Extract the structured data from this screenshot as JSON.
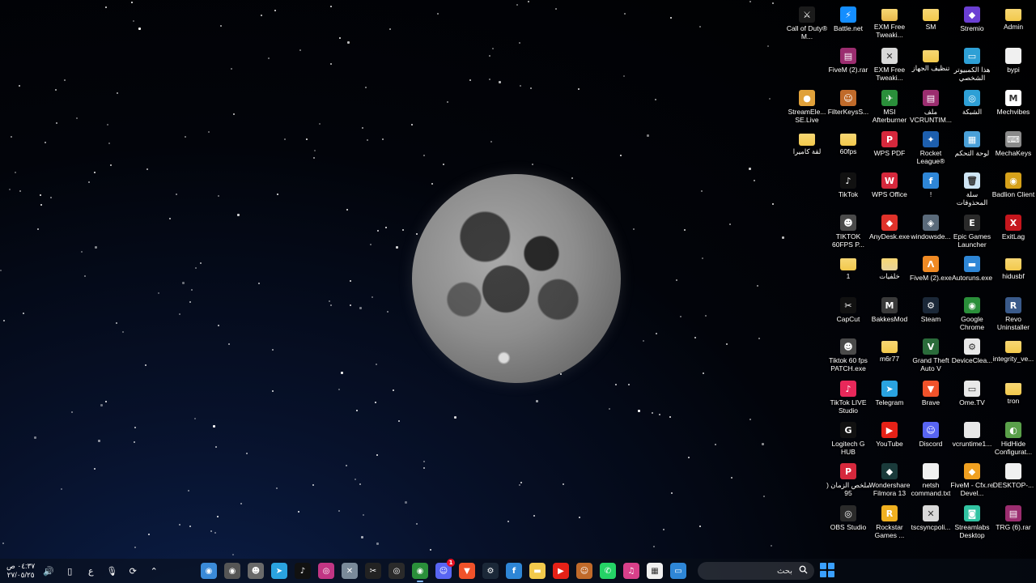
{
  "desktop": {
    "icons": [
      {
        "label": "Call of Duty® M...",
        "icon": "cod-icon",
        "color": "#1b1b1b",
        "glyph": "⚔",
        "col": 0,
        "row": 0
      },
      {
        "label": "Battle.net",
        "icon": "battlenet-icon",
        "color": "#148eff",
        "glyph": "⚡",
        "col": 1,
        "row": 0
      },
      {
        "label": "EXM Free Tweaki...",
        "icon": "folder-icon",
        "color": "#e8b84a",
        "glyph": "",
        "col": 2,
        "row": 0
      },
      {
        "label": "SM",
        "icon": "folder-icon",
        "color": "#f2c94c",
        "glyph": "",
        "col": 3,
        "row": 0
      },
      {
        "label": "Stremio",
        "icon": "stremio-icon",
        "color": "#6b3fd3",
        "glyph": "◆",
        "col": 4,
        "row": 0
      },
      {
        "label": "Admin",
        "icon": "folder-icon",
        "color": "#f2c94c",
        "glyph": "",
        "col": 5,
        "row": 0
      },
      {
        "label": "FiveM (2).rar",
        "icon": "winrar-icon",
        "color": "#9b2d6f",
        "glyph": "▤",
        "col": 1,
        "row": 1
      },
      {
        "label": "EXM Free Tweaki...",
        "icon": "shortcut-icon",
        "color": "#d9d9d9",
        "glyph": "✕",
        "col": 2,
        "row": 1
      },
      {
        "label": "تنظيف الجهاز",
        "icon": "folder-icon",
        "color": "#f2c94c",
        "glyph": "",
        "col": 3,
        "row": 1
      },
      {
        "label": "هذا الكمبيوتر الشخصي",
        "icon": "this-pc-icon",
        "color": "#2ea0d6",
        "glyph": "▭",
        "col": 4,
        "row": 1
      },
      {
        "label": "bypi",
        "icon": "file-icon",
        "color": "#f0f0f0",
        "glyph": "",
        "col": 5,
        "row": 1
      },
      {
        "label": "StreamEle... SE.Live",
        "icon": "streamelements-icon",
        "color": "#e0a13a",
        "glyph": "●",
        "col": 0,
        "row": 2
      },
      {
        "label": "FilterKeysS...",
        "icon": "filterkeys-icon",
        "color": "#c06a2a",
        "glyph": "☺",
        "col": 1,
        "row": 2
      },
      {
        "label": "MSI Afterburner",
        "icon": "msi-afterburner-icon",
        "color": "#2a8f3a",
        "glyph": "✈",
        "col": 2,
        "row": 2
      },
      {
        "label": "ملف VCRUNTIM...",
        "icon": "winrar-icon",
        "color": "#9b2d6f",
        "glyph": "▤",
        "col": 3,
        "row": 2
      },
      {
        "label": "الشبكة",
        "icon": "network-icon",
        "color": "#2ea0d6",
        "glyph": "◎",
        "col": 4,
        "row": 2
      },
      {
        "label": "Mechvibes",
        "icon": "mechvibes-icon",
        "color": "#ffffff",
        "glyph": "M",
        "col": 5,
        "row": 2
      },
      {
        "label": "لقة كاميرا",
        "icon": "folder-icon",
        "color": "#f2c94c",
        "glyph": "",
        "col": 0,
        "row": 3
      },
      {
        "label": "60fps",
        "icon": "folder-icon",
        "color": "#f2c94c",
        "glyph": "",
        "col": 1,
        "row": 3
      },
      {
        "label": "WPS PDF",
        "icon": "wps-pdf-icon",
        "color": "#d6283c",
        "glyph": "P",
        "col": 2,
        "row": 3
      },
      {
        "label": "Rocket League®",
        "icon": "rocket-league-icon",
        "color": "#1d5fae",
        "glyph": "✦",
        "col": 3,
        "row": 3
      },
      {
        "label": "لوحة التحكم",
        "icon": "control-panel-icon",
        "color": "#4aa0d8",
        "glyph": "▦",
        "col": 4,
        "row": 3
      },
      {
        "label": "MechaKeys",
        "icon": "mechakeys-icon",
        "color": "#8a8a8a",
        "glyph": "⌨",
        "col": 5,
        "row": 3
      },
      {
        "label": "TikTok",
        "icon": "tiktok-icon",
        "color": "#111111",
        "glyph": "♪",
        "col": 1,
        "row": 4
      },
      {
        "label": "WPS Office",
        "icon": "wps-office-icon",
        "color": "#d6283c",
        "glyph": "W",
        "col": 2,
        "row": 4
      },
      {
        "label": "!",
        "icon": "fivem-file-icon",
        "color": "#2e86d6",
        "glyph": "f",
        "col": 3,
        "row": 4
      },
      {
        "label": "سلة المحذوفات",
        "icon": "recycle-bin-icon",
        "color": "#cfe6f5",
        "glyph": "🗑",
        "col": 4,
        "row": 4
      },
      {
        "label": "Badlion Client",
        "icon": "badlion-icon",
        "color": "#d6a11a",
        "glyph": "◉",
        "col": 5,
        "row": 4
      },
      {
        "label": "TIKTOK 60FPS P...",
        "icon": "avatar-icon",
        "color": "#4a4a4a",
        "glyph": "☻",
        "col": 1,
        "row": 5
      },
      {
        "label": "AnyDesk.exe",
        "icon": "anydesk-icon",
        "color": "#e0322a",
        "glyph": "◆",
        "col": 2,
        "row": 5
      },
      {
        "label": "windowsde...",
        "icon": "windowsdefender-icon",
        "color": "#5a6a7a",
        "glyph": "◈",
        "col": 3,
        "row": 5
      },
      {
        "label": "Epic Games Launcher",
        "icon": "epic-games-icon",
        "color": "#2a2a2a",
        "glyph": "E",
        "col": 4,
        "row": 5
      },
      {
        "label": "ExitLag",
        "icon": "exitlag-icon",
        "color": "#c5161d",
        "glyph": "X",
        "col": 5,
        "row": 5
      },
      {
        "label": "1",
        "icon": "folder-icon",
        "color": "#f2c94c",
        "glyph": "",
        "col": 1,
        "row": 6
      },
      {
        "label": "خلفيات",
        "icon": "folder-icon",
        "color": "#e8d39a",
        "glyph": "",
        "col": 2,
        "row": 6
      },
      {
        "label": "FiveM (2).exe",
        "icon": "fivem-icon",
        "color": "#f08a24",
        "glyph": "Λ",
        "col": 3,
        "row": 6
      },
      {
        "label": "Autoruns.exe",
        "icon": "autoruns-icon",
        "color": "#2e86d6",
        "glyph": "▬",
        "col": 4,
        "row": 6
      },
      {
        "label": "hidusbf",
        "icon": "folder-icon",
        "color": "#f2c94c",
        "glyph": "",
        "col": 5,
        "row": 6
      },
      {
        "label": "CapCut",
        "icon": "capcut-icon",
        "color": "#111111",
        "glyph": "✂",
        "col": 1,
        "row": 7
      },
      {
        "label": "BakkesMod",
        "icon": "bakkesmod-icon",
        "color": "#3a3a3a",
        "glyph": "M",
        "col": 2,
        "row": 7
      },
      {
        "label": "Steam",
        "icon": "steam-icon",
        "color": "#1b2838",
        "glyph": "⚙",
        "col": 3,
        "row": 7
      },
      {
        "label": "Google Chrome",
        "icon": "chrome-icon",
        "color": "#2a8f3a",
        "glyph": "◉",
        "col": 4,
        "row": 7
      },
      {
        "label": "Revo Uninstaller",
        "icon": "revo-icon",
        "color": "#3a5a8a",
        "glyph": "R",
        "col": 5,
        "row": 7
      },
      {
        "label": "Tiktok 60 fps PATCH.exe",
        "icon": "avatar-icon",
        "color": "#4a4a4a",
        "glyph": "☻",
        "col": 1,
        "row": 8
      },
      {
        "label": "m6r77",
        "icon": "folder-icon",
        "color": "#f2c94c",
        "glyph": "",
        "col": 2,
        "row": 8
      },
      {
        "label": "Grand Theft Auto V",
        "icon": "gta-icon",
        "color": "#2a6b3a",
        "glyph": "V",
        "col": 3,
        "row": 8
      },
      {
        "label": "DeviceClea...",
        "icon": "deviceclean-icon",
        "color": "#e8e8e8",
        "glyph": "⚙",
        "col": 4,
        "row": 8
      },
      {
        "label": "integrity_ve...",
        "icon": "folder-icon",
        "color": "#f2c94c",
        "glyph": "",
        "col": 5,
        "row": 8
      },
      {
        "label": "TikTok LIVE Studio",
        "icon": "tiktok-live-icon",
        "color": "#e8285a",
        "glyph": "♪",
        "col": 1,
        "row": 9
      },
      {
        "label": "Telegram",
        "icon": "telegram-icon",
        "color": "#2aa3e0",
        "glyph": "➤",
        "col": 2,
        "row": 9
      },
      {
        "label": "Brave",
        "icon": "brave-icon",
        "color": "#f0522a",
        "glyph": "▼",
        "col": 3,
        "row": 9
      },
      {
        "label": "Ome.TV",
        "icon": "ometv-icon",
        "color": "#e8e8e8",
        "glyph": "▭",
        "col": 4,
        "row": 9
      },
      {
        "label": "tron",
        "icon": "folder-icon",
        "color": "#f2c94c",
        "glyph": "",
        "col": 5,
        "row": 9
      },
      {
        "label": "Logitech G HUB",
        "icon": "logitech-icon",
        "color": "#111111",
        "glyph": "G",
        "col": 1,
        "row": 10
      },
      {
        "label": "YouTube",
        "icon": "youtube-icon",
        "color": "#e62117",
        "glyph": "▶",
        "col": 2,
        "row": 10
      },
      {
        "label": "Discord",
        "icon": "discord-icon",
        "color": "#5865f2",
        "glyph": "☺",
        "col": 3,
        "row": 10
      },
      {
        "label": "vcruntime1...",
        "icon": "file-icon",
        "color": "#e8e8e8",
        "glyph": "",
        "col": 4,
        "row": 10
      },
      {
        "label": "HidHide Configurat...",
        "icon": "hidhide-icon",
        "color": "#5aa04a",
        "glyph": "◐",
        "col": 5,
        "row": 10
      },
      {
        "label": "ملخص الزمان ( 95",
        "icon": "pdf-icon",
        "color": "#d6283c",
        "glyph": "P",
        "col": 1,
        "row": 11
      },
      {
        "label": "Wondershare Filmora 13",
        "icon": "filmora-icon",
        "color": "#1a3a3a",
        "glyph": "◆",
        "col": 2,
        "row": 11
      },
      {
        "label": "netsh command.txt",
        "icon": "text-file-icon",
        "color": "#f0f0f0",
        "glyph": "",
        "col": 3,
        "row": 11
      },
      {
        "label": "FiveM - Cfx.re Devel...",
        "icon": "fivem-dev-icon",
        "color": "#f0a020",
        "glyph": "◆",
        "col": 4,
        "row": 11
      },
      {
        "label": "DESKTOP-...",
        "icon": "file-icon",
        "color": "#f0f0f0",
        "glyph": "",
        "col": 5,
        "row": 11
      },
      {
        "label": "OBS Studio",
        "icon": "obs-icon",
        "color": "#2a2a2a",
        "glyph": "◎",
        "col": 1,
        "row": 12
      },
      {
        "label": "Rockstar Games ...",
        "icon": "rockstar-icon",
        "color": "#f0b020",
        "glyph": "R",
        "col": 2,
        "row": 12
      },
      {
        "label": "tscsyncpoli...",
        "icon": "shortcut-icon",
        "color": "#d9d9d9",
        "glyph": "✕",
        "col": 3,
        "row": 12
      },
      {
        "label": "Streamlabs Desktop",
        "icon": "streamlabs-icon",
        "color": "#31c3a2",
        "glyph": "◙",
        "col": 4,
        "row": 12
      },
      {
        "label": "TRG (6).rar",
        "icon": "winrar-icon",
        "color": "#9b2d6f",
        "glyph": "▤",
        "col": 5,
        "row": 12
      }
    ]
  },
  "taskbar": {
    "clock_time": "٠٤:٣٧ ص",
    "clock_date": "٢٧/٠٥/٢٥",
    "lang": "ع",
    "search_placeholder": "بحث",
    "tray": [
      {
        "icon": "volume-icon",
        "glyph": "🔊"
      },
      {
        "icon": "network-icon",
        "glyph": "▯"
      },
      {
        "icon": "microphone-icon",
        "glyph": "🎙"
      },
      {
        "icon": "sync-icon",
        "glyph": "⟳"
      },
      {
        "icon": "chevron-up-icon",
        "glyph": "⌃"
      }
    ],
    "apps": [
      {
        "icon": "safari-icon",
        "color": "#3a8ad8",
        "glyph": "◉"
      },
      {
        "icon": "app-icon",
        "color": "#555555",
        "glyph": "◉",
        "badge": ""
      },
      {
        "icon": "avatar-app-icon",
        "color": "#6a6a6a",
        "glyph": "☻"
      },
      {
        "icon": "telegram-icon",
        "color": "#2aa3e0",
        "glyph": "➤"
      },
      {
        "icon": "tiktok-icon",
        "color": "#111111",
        "glyph": "♪"
      },
      {
        "icon": "instagram-icon",
        "color": "#c13584",
        "glyph": "◎"
      },
      {
        "icon": "tool-icon",
        "color": "#7a8a9a",
        "glyph": "✕"
      },
      {
        "icon": "capcut-icon",
        "color": "#222222",
        "glyph": "✂"
      },
      {
        "icon": "obs-icon",
        "color": "#2a2a2a",
        "glyph": "◎"
      },
      {
        "icon": "chrome-icon",
        "color": "#2a8f3a",
        "glyph": "◉",
        "active": true
      },
      {
        "icon": "discord-icon",
        "color": "#5865f2",
        "glyph": "☺",
        "badge": "1"
      },
      {
        "icon": "brave-icon",
        "color": "#f0522a",
        "glyph": "▼"
      },
      {
        "icon": "steam-icon",
        "color": "#1b2838",
        "glyph": "⚙"
      },
      {
        "icon": "fivem-file-icon",
        "color": "#2e86d6",
        "glyph": "f"
      },
      {
        "icon": "file-explorer-icon",
        "color": "#f2c94c",
        "glyph": "▬"
      },
      {
        "icon": "youtube-icon",
        "color": "#e62117",
        "glyph": "▶"
      },
      {
        "icon": "store-icon",
        "color": "#c06a2a",
        "glyph": "☺"
      },
      {
        "icon": "whatsapp-icon",
        "color": "#25d366",
        "glyph": "✆"
      },
      {
        "icon": "itunes-icon",
        "color": "#d8408a",
        "glyph": "♫"
      },
      {
        "icon": "microsoft-store-icon",
        "color": "#f0f0f0",
        "glyph": "▦"
      },
      {
        "icon": "window-icon",
        "color": "#2e86d6",
        "glyph": "▭"
      }
    ]
  }
}
